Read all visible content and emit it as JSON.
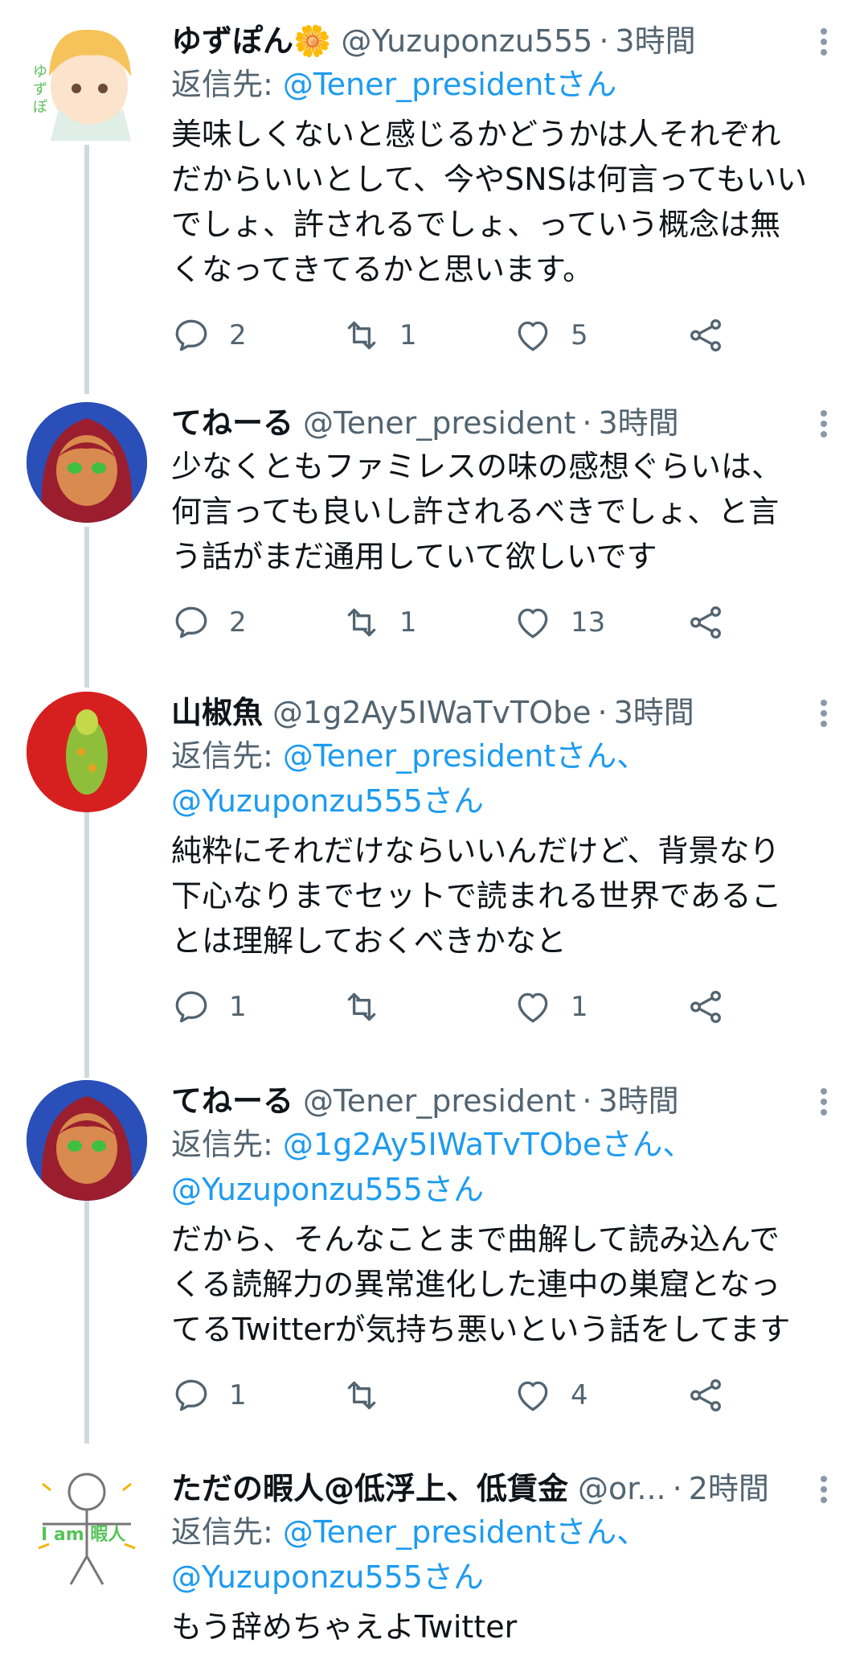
{
  "tweets": [
    {
      "name": "ゆずぽん🌼",
      "handle": "@Yuzuponzu555",
      "time": "3時間",
      "reply_label": "返信先:",
      "reply_mentions": "@Tener_presidentさん",
      "text": "美味しくないと感じるかどうかは人それぞれ\nだからいいとして、今やSNSは何言ってもいい\nでしょ、許されるでしょ、っていう概念は無\nくなってきてるかと思います。",
      "replies": "2",
      "retweets": "1",
      "likes": "5"
    },
    {
      "name": "てねーる",
      "handle": "@Tener_president",
      "time": "3時間",
      "text": "少なくともファミレスの味の感想ぐらいは、\n何言っても良いし許されるべきでしょ、と言\nう話がまだ通用していて欲しいです",
      "replies": "2",
      "retweets": "1",
      "likes": "13"
    },
    {
      "name": "山椒魚",
      "handle": "@1g2Ay5IWaTvTObe",
      "time": "3時間",
      "reply_label": "返信先:",
      "reply_mentions": "@Tener_presidentさん、\n@Yuzuponzu555さん",
      "text": "純粋にそれだけならいいんだけど、背景なり\n下心なりまでセットで読まれる世界であるこ\nとは理解しておくべきかなと",
      "replies": "1",
      "retweets": "",
      "likes": "1"
    },
    {
      "name": "てねーる",
      "handle": "@Tener_president",
      "time": "3時間",
      "reply_label": "返信先:",
      "reply_mentions": "@1g2Ay5IWaTvTObeさん、\n@Yuzuponzu555さん",
      "text": "だから、そんなことまで曲解して読み込んで\nくる読解力の異常進化した連中の巣窟となっ\nてるTwitterが気持ち悪いという話をしてます",
      "replies": "1",
      "retweets": "",
      "likes": "4"
    },
    {
      "name": "ただの暇人@低浮上、低賃金",
      "handle": "@or...",
      "time": "2時間",
      "reply_label": "返信先:",
      "reply_mentions": "@Tener_presidentさん、\n@Yuzuponzu555さん",
      "text": "もう辞めちゃえよTwitter"
    }
  ],
  "avatar5_label": "I am 暇人",
  "colors": {
    "link": "#1d9bf0",
    "secondary": "#536471",
    "thread_line": "#cfd9de"
  }
}
